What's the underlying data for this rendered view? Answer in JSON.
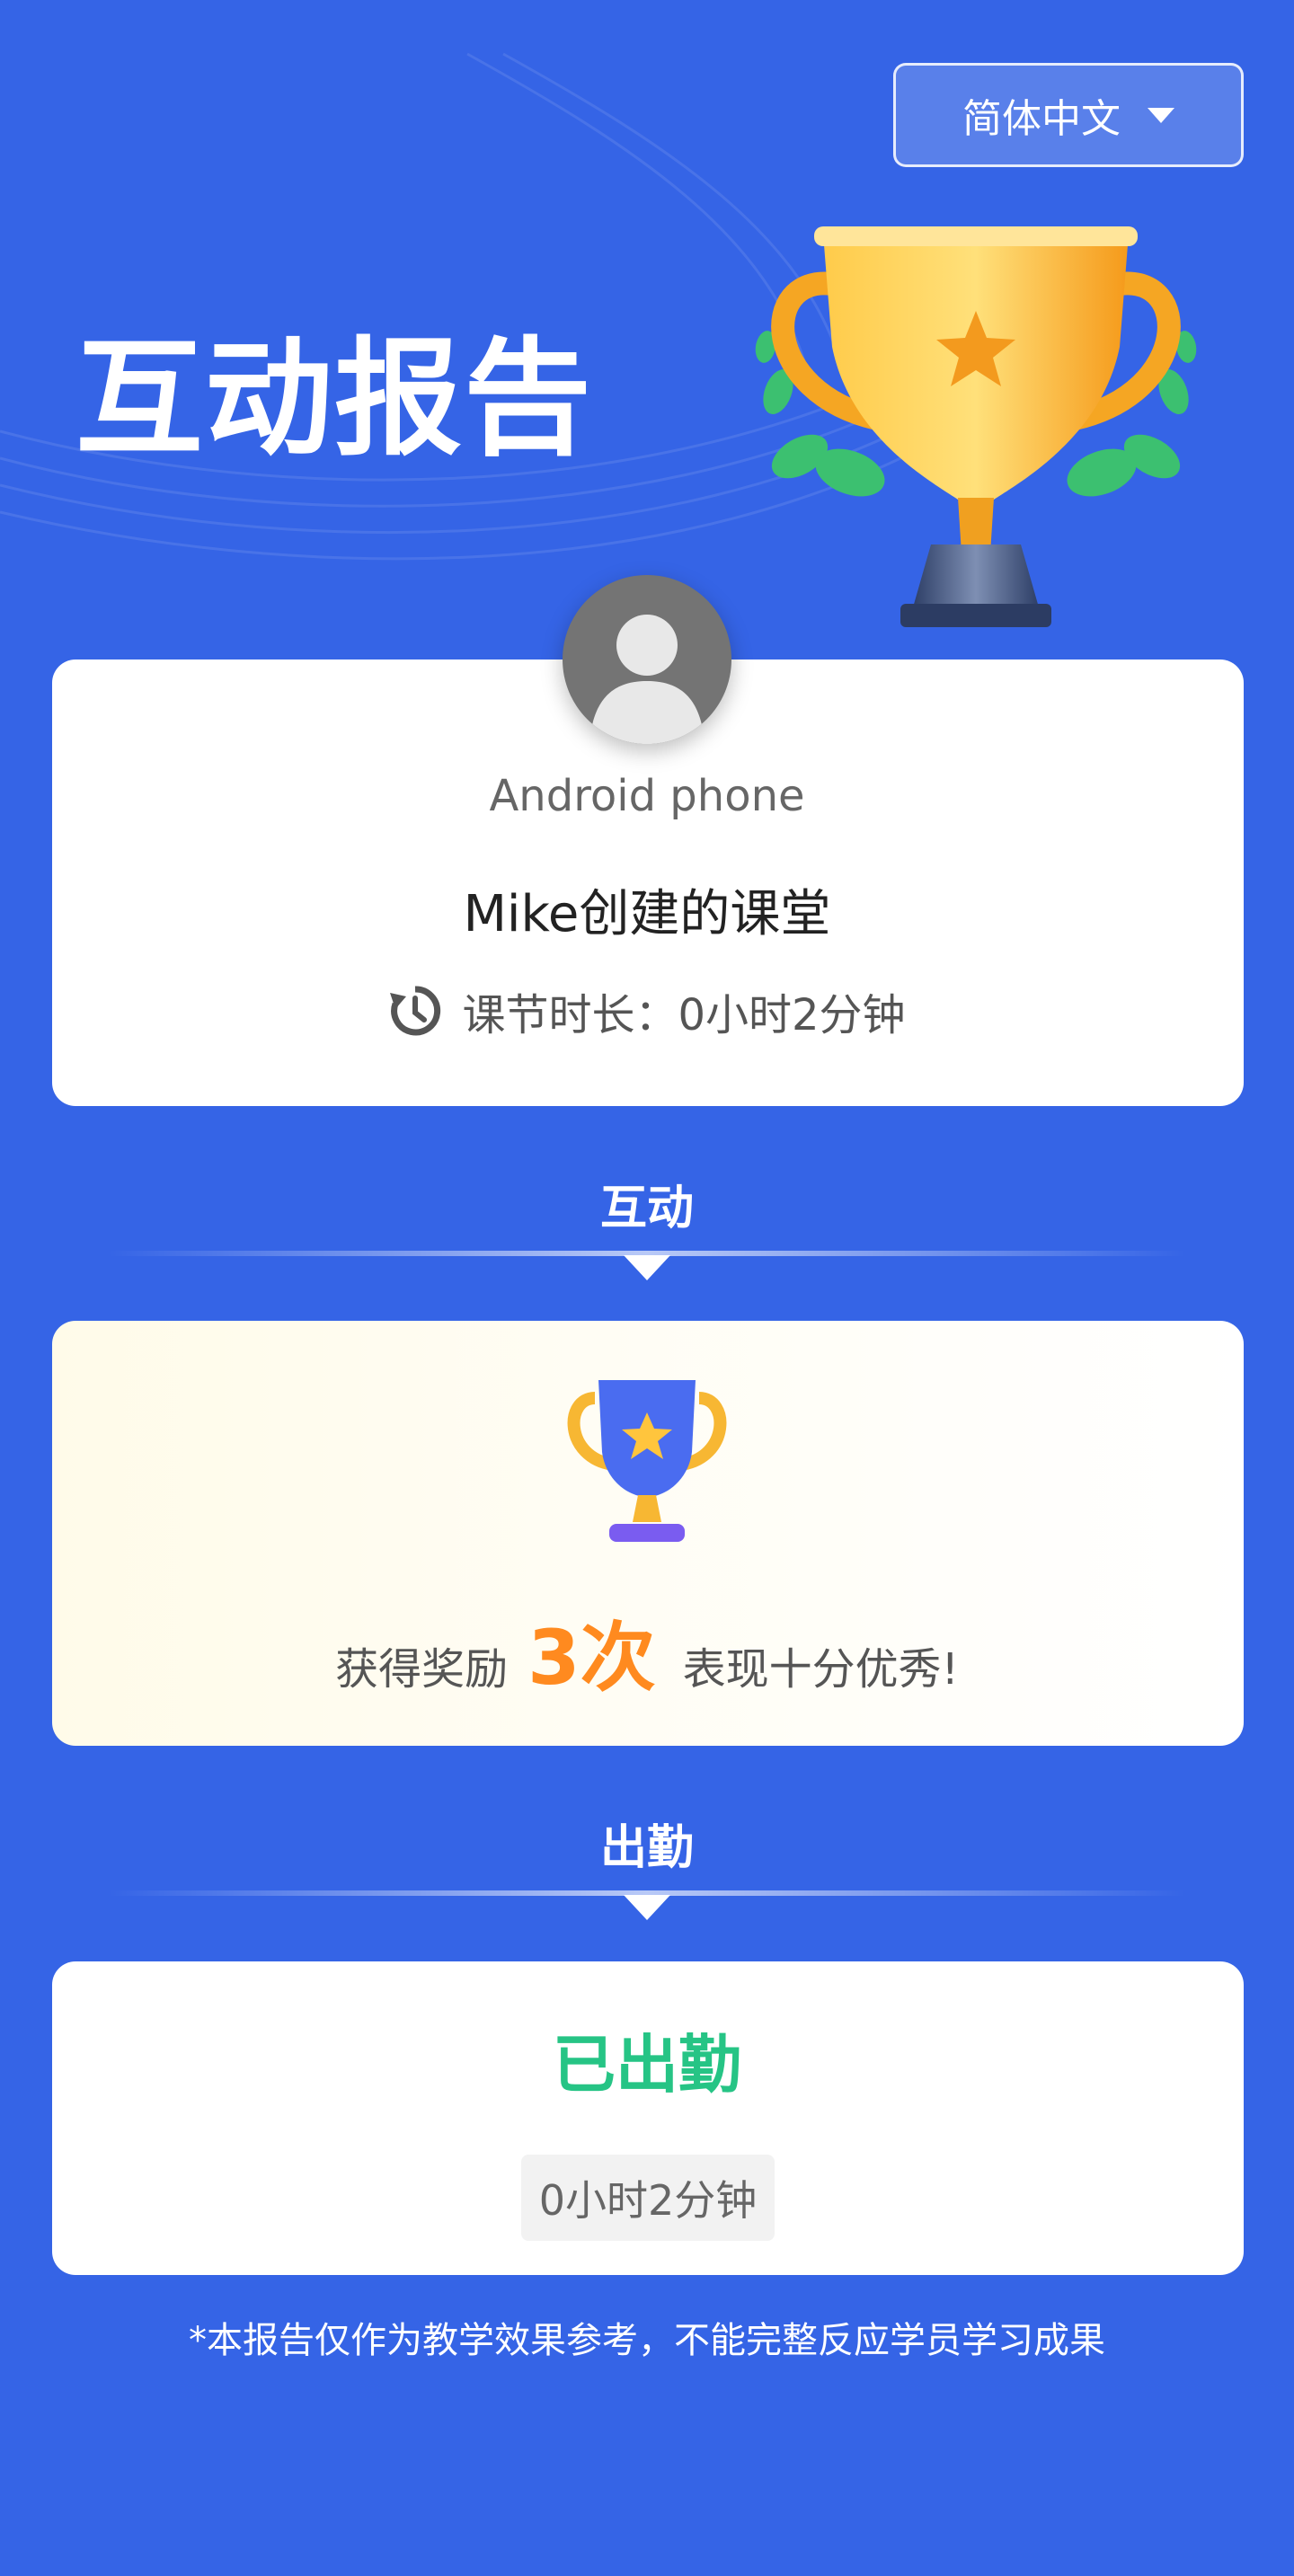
{
  "header": {
    "language_label": "简体中文",
    "page_title": "互动报告"
  },
  "info": {
    "device_name": "Android phone",
    "class_name": "Mike创建的课堂",
    "duration_label": "课节时长：",
    "duration_value": "0小时2分钟"
  },
  "interaction": {
    "section_title": "互动",
    "reward_prefix": "获得奖励",
    "reward_count": "3次",
    "reward_suffix": "表现十分优秀!"
  },
  "attendance": {
    "section_title": "出勤",
    "status": "已出勤",
    "time": "0小时2分钟"
  },
  "footer": {
    "disclaimer": "*本报告仅作为教学效果参考，不能完整反应学员学习成果"
  },
  "colors": {
    "background": "#3564e6",
    "attended_green": "#26c485",
    "reward_orange": "#ff8a1f"
  },
  "icons": [
    "chevron-down-icon",
    "trophy-icon",
    "avatar-icon",
    "clock-history-icon",
    "trophy-small-icon"
  ]
}
